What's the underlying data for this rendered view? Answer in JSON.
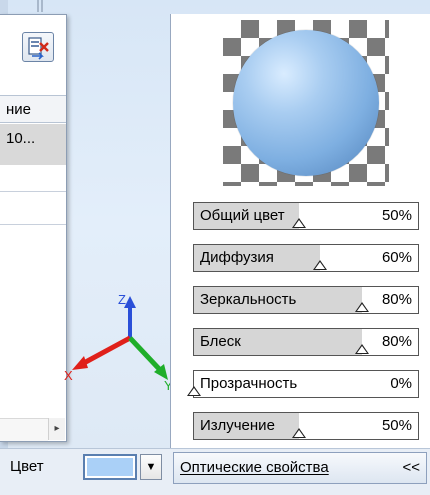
{
  "left_panel": {
    "header_text": "ние",
    "selected_row_text": "10..."
  },
  "axes": {
    "x": "X",
    "y": "Y",
    "z": "Z"
  },
  "optical_properties": {
    "rows": [
      {
        "label": "Общий цвет",
        "value": "50%",
        "fraction": 0.5
      },
      {
        "label": "Диффузия",
        "value": "60%",
        "fraction": 0.6
      },
      {
        "label": "Зеркальность",
        "value": "80%",
        "fraction": 0.8
      },
      {
        "label": "Блеск",
        "value": "80%",
        "fraction": 0.8
      },
      {
        "label": "Прозрачность",
        "value": "0%",
        "fraction": 0.0
      },
      {
        "label": "Излучение",
        "value": "50%",
        "fraction": 0.5
      }
    ]
  },
  "bottom_bar": {
    "color_label": "Цвет",
    "color_value": "#aad0f7",
    "optics_button_label": "Оптические свойства",
    "optics_button_chevron": "<<"
  },
  "colors": {
    "axis_x": "#e0201a",
    "axis_y": "#1fae2a",
    "axis_z": "#2a4fd8",
    "sphere": "#8fbde9"
  }
}
